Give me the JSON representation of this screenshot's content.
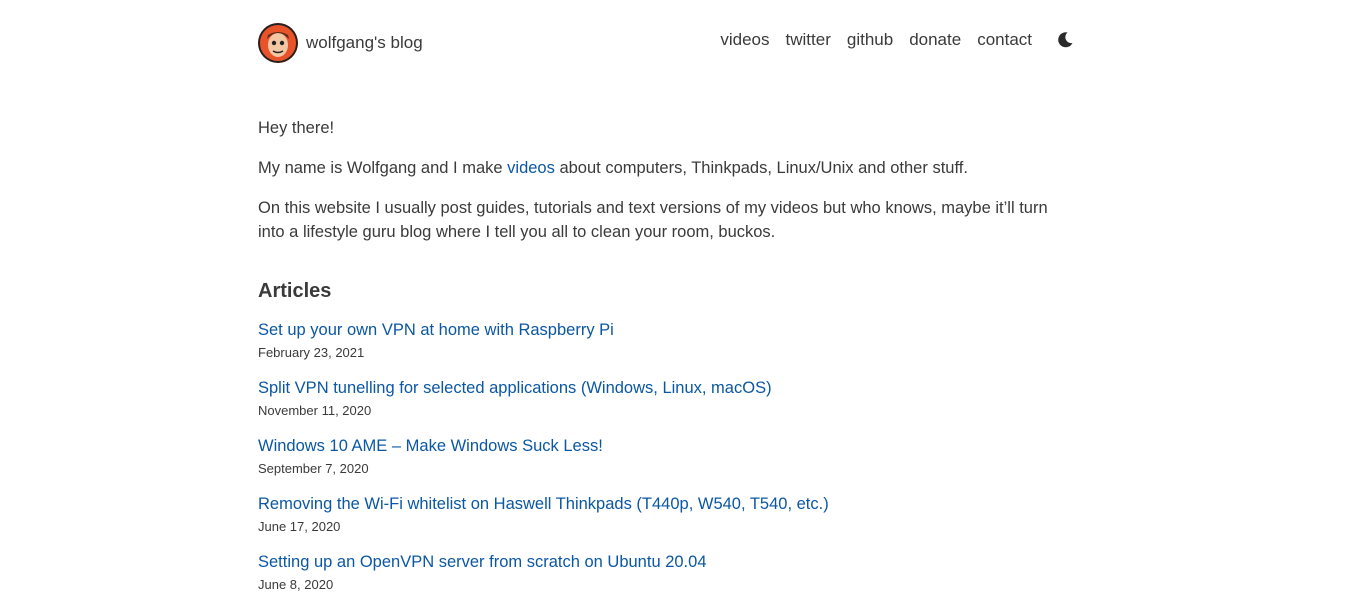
{
  "header": {
    "brand_name": "wolfgang's blog",
    "nav": [
      "videos",
      "twitter",
      "github",
      "donate",
      "contact"
    ],
    "theme_icon": "moon-icon"
  },
  "intro": {
    "greeting": "Hey there!",
    "line2_before": "My name is Wolfgang and I make ",
    "line2_link": "videos",
    "line2_after": " about computers, Thinkpads, Linux/Unix and other stuff.",
    "line3": "On this website I usually post guides, tutorials and text versions of my videos but who knows, maybe it’ll turn into a lifestyle guru blog where I tell you all to clean your room, buckos."
  },
  "articles": {
    "heading": "Articles",
    "items": [
      {
        "title": "Set up your own VPN at home with Raspberry Pi",
        "date": "February 23, 2021"
      },
      {
        "title": "Split VPN tunelling for selected applications (Windows, Linux, macOS)",
        "date": "November 11, 2020"
      },
      {
        "title": "Windows 10 AME – Make Windows Suck Less!",
        "date": "September 7, 2020"
      },
      {
        "title": "Removing the Wi-Fi whitelist on Haswell Thinkpads (T440p, W540, T540, etc.)",
        "date": "June 17, 2020"
      },
      {
        "title": "Setting up an OpenVPN server from scratch on Ubuntu 20.04",
        "date": "June 8, 2020"
      }
    ]
  },
  "colors": {
    "link": "#0b57a4",
    "text": "#3a3a3a",
    "avatar_bg": "#e8532a"
  }
}
